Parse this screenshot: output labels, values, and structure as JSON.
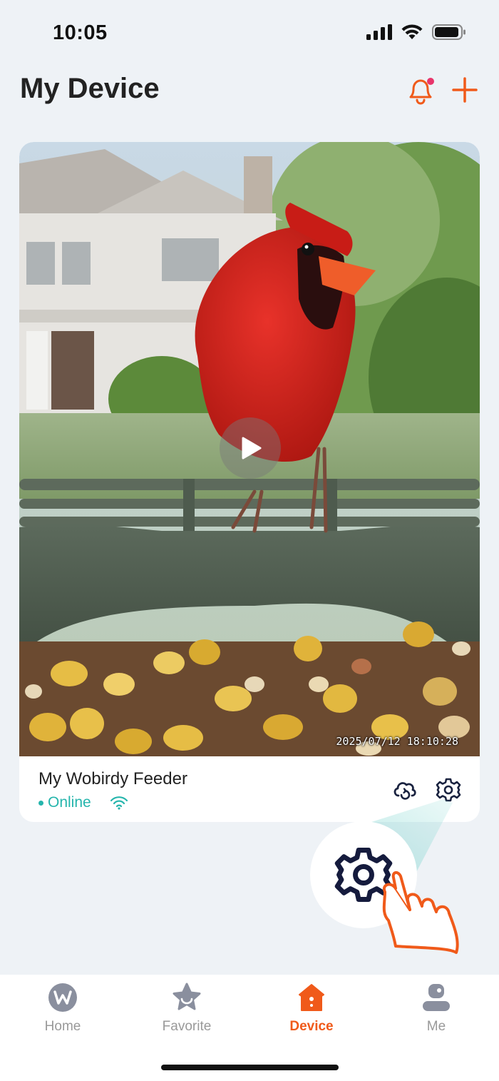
{
  "status_bar": {
    "time": "10:05",
    "icons": [
      "cellular-signal-icon",
      "wifi-icon",
      "battery-icon"
    ]
  },
  "header": {
    "title": "My Device",
    "actions": [
      "bell-notification-icon",
      "add-icon"
    ],
    "accent_color": "#f05a1a",
    "badge_color": "#e8356b"
  },
  "device_card": {
    "name": "My Wobirdy Feeder",
    "status": "Online",
    "status_color": "#25b5ac",
    "timestamp": "2025/07/12 18:10:28",
    "actions": [
      "cloud-playback-icon",
      "settings-gear-icon"
    ]
  },
  "tab_bar": {
    "tabs": [
      {
        "label": "Home",
        "icon": "wobirdy-logo-icon"
      },
      {
        "label": "Favorite",
        "icon": "star-face-icon"
      },
      {
        "label": "Device",
        "icon": "birdhouse-icon"
      },
      {
        "label": "Me",
        "icon": "user-icon"
      }
    ],
    "active": "Device"
  }
}
